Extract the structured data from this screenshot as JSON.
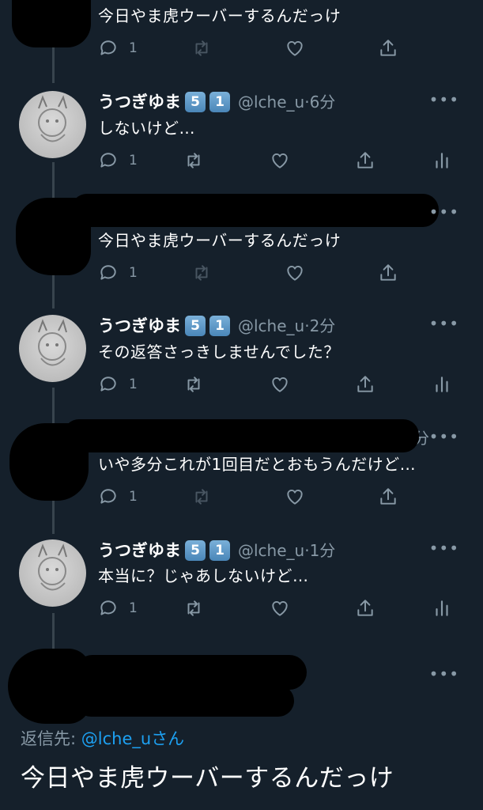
{
  "tweets": [
    {
      "text": "今日やま虎ウーバーするんだっけ",
      "reply_count": "1"
    },
    {
      "name": "うつぎゆま",
      "badges": [
        "5",
        "1"
      ],
      "handle": "@lche_u",
      "time": "·6分",
      "text": "しないけど…",
      "reply_count": "1"
    },
    {
      "text": "今日やま虎ウーバーするんだっけ",
      "reply_count": "1"
    },
    {
      "name": "うつぎゆま",
      "badges": [
        "5",
        "1"
      ],
      "handle": "@lche_u",
      "time": "·2分",
      "text": "その返答さっきしませんでした？",
      "reply_count": "1"
    },
    {
      "text": "いや多分これが1回目だとおもうんだけど…",
      "reply_count": "1",
      "time_fragment": "分"
    },
    {
      "name": "うつぎゆま",
      "badges": [
        "5",
        "1"
      ],
      "handle": "@lche_u",
      "time": "·1分",
      "text": "本当に？じゃあしないけど…",
      "reply_count": "1"
    }
  ],
  "more_label": "•••",
  "reply_to": {
    "prefix": "返信先: ",
    "handle": "@lche_u",
    "suffix": "さん"
  },
  "main_tweet_text": "今日やま虎ウーバーするんだっけ",
  "icons": [
    "reply-icon",
    "retweet-icon",
    "like-icon",
    "share-icon",
    "analytics-icon",
    "more-icon"
  ],
  "colors": {
    "background": "#15202b",
    "text": "#ffffff",
    "muted": "#8899a6",
    "link": "#1da1f2",
    "thread_line": "#38444d"
  }
}
